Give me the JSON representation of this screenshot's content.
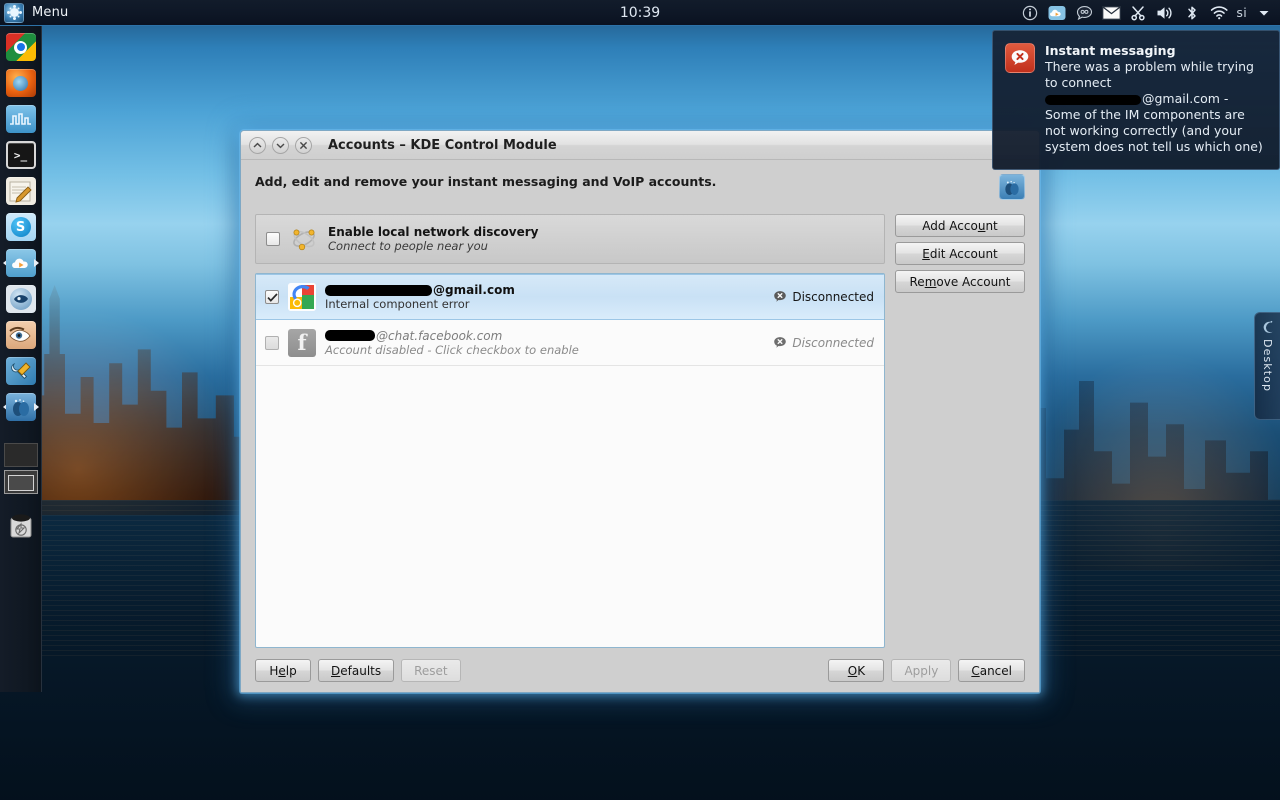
{
  "panel": {
    "menu_label": "Menu",
    "menu_icon": "kde-menu-icon",
    "clock": "10:39",
    "tray": [
      {
        "name": "info-icon",
        "glyph": "i"
      },
      {
        "name": "cloud-media-icon",
        "glyph": ""
      },
      {
        "name": "chat-bubble-icon",
        "glyph": ""
      },
      {
        "name": "mail-envelope-icon",
        "glyph": ""
      },
      {
        "name": "klipper-scissors-icon",
        "glyph": ""
      },
      {
        "name": "volume-icon",
        "glyph": ""
      },
      {
        "name": "bluetooth-icon",
        "glyph": ""
      },
      {
        "name": "wifi-icon",
        "glyph": ""
      },
      {
        "name": "keyboard-layout-icon",
        "glyph": "si"
      },
      {
        "name": "tray-expand-arrow-icon",
        "glyph": "▼"
      }
    ]
  },
  "dock": {
    "items": [
      {
        "name": "launcher-chrome",
        "label": "Chrome"
      },
      {
        "name": "launcher-firefox",
        "label": "Firefox"
      },
      {
        "name": "launcher-wireshark",
        "label": "Wireshark"
      },
      {
        "name": "launcher-terminal",
        "label": "Terminal"
      },
      {
        "name": "launcher-notes",
        "label": "Notes"
      },
      {
        "name": "launcher-skype",
        "label": "Skype"
      },
      {
        "name": "launcher-cloud-player",
        "label": "Cloud Player"
      },
      {
        "name": "launcher-konqueror",
        "label": "Konqueror"
      },
      {
        "name": "launcher-eye-viewer",
        "label": "Viewer"
      },
      {
        "name": "launcher-system-settings",
        "label": "System Settings"
      },
      {
        "name": "taskbar-item-telepathy",
        "label": "Accounts"
      }
    ],
    "pager": {
      "desktops": 2,
      "active": 2
    },
    "trash_label": "Trash"
  },
  "desktop_tab": {
    "label": "Desktop",
    "icon": "cashew-icon"
  },
  "notification": {
    "title": "Instant messaging",
    "line1": "There was a problem while trying",
    "line2": "to connect",
    "line3_suffix": "@gmail.com -",
    "line4": "Some of the IM components are",
    "line5": "not working correctly (and your",
    "line6": "system does not tell us which one)",
    "icon": "error-chat-icon",
    "icon_color": "#cf3a24"
  },
  "window": {
    "title": "Accounts – KDE Control Module",
    "titlebar_buttons": [
      {
        "name": "shade-button",
        "glyph": "⌃"
      },
      {
        "name": "minimize-button",
        "glyph": "⌄"
      },
      {
        "name": "close-button",
        "glyph": "✕"
      }
    ],
    "caption": "Add, edit and remove your instant messaging and VoIP accounts.",
    "kcm_icon": "telepathy-accounts-icon"
  },
  "lan_discovery": {
    "checked": false,
    "title": "Enable local network discovery",
    "subtitle": "Connect to people near you",
    "icon": "salut-local-network-icon"
  },
  "accounts": [
    {
      "name": "account-row-gmail",
      "icon": "google-talk-icon",
      "enabled": true,
      "selected": true,
      "name_suffix": "@gmail.com",
      "status_text": "Internal component error",
      "connection": "Disconnected",
      "status_icon": "disconnected-icon",
      "dim": false
    },
    {
      "name": "account-row-facebook",
      "icon": "facebook-chat-icon",
      "enabled": false,
      "selected": false,
      "name_suffix": "@chat.facebook.com",
      "status_text": "Account disabled - Click checkbox to enable",
      "connection": "Disconnected",
      "status_icon": "disconnected-icon",
      "dim": true
    }
  ],
  "side_buttons": [
    {
      "name": "add-account-button",
      "label": "Add Account",
      "mnemonic": "u",
      "disabled": false
    },
    {
      "name": "edit-account-button",
      "label": "Edit Account",
      "mnemonic": "E",
      "disabled": false
    },
    {
      "name": "remove-account-button",
      "label": "Remove Account",
      "mnemonic": "m",
      "disabled": false
    }
  ],
  "bottom_buttons_left": [
    {
      "name": "help-button",
      "label": "Help",
      "mnemonic": "e",
      "disabled": false
    },
    {
      "name": "defaults-button",
      "label": "Defaults",
      "mnemonic": "D",
      "disabled": false
    },
    {
      "name": "reset-button",
      "label": "Reset",
      "mnemonic": "",
      "disabled": true
    }
  ],
  "bottom_buttons_right": [
    {
      "name": "ok-button",
      "label": "OK",
      "mnemonic": "O",
      "disabled": false
    },
    {
      "name": "apply-button",
      "label": "Apply",
      "mnemonic": "",
      "disabled": true
    },
    {
      "name": "cancel-button",
      "label": "Cancel",
      "mnemonic": "C",
      "disabled": false
    }
  ],
  "colors": {
    "accent": "#3b7fb5",
    "selection": "#c9e1f5",
    "window_bg": "#cfcfcf",
    "panel_bg": "#0e1726",
    "error": "#cf3a24"
  }
}
